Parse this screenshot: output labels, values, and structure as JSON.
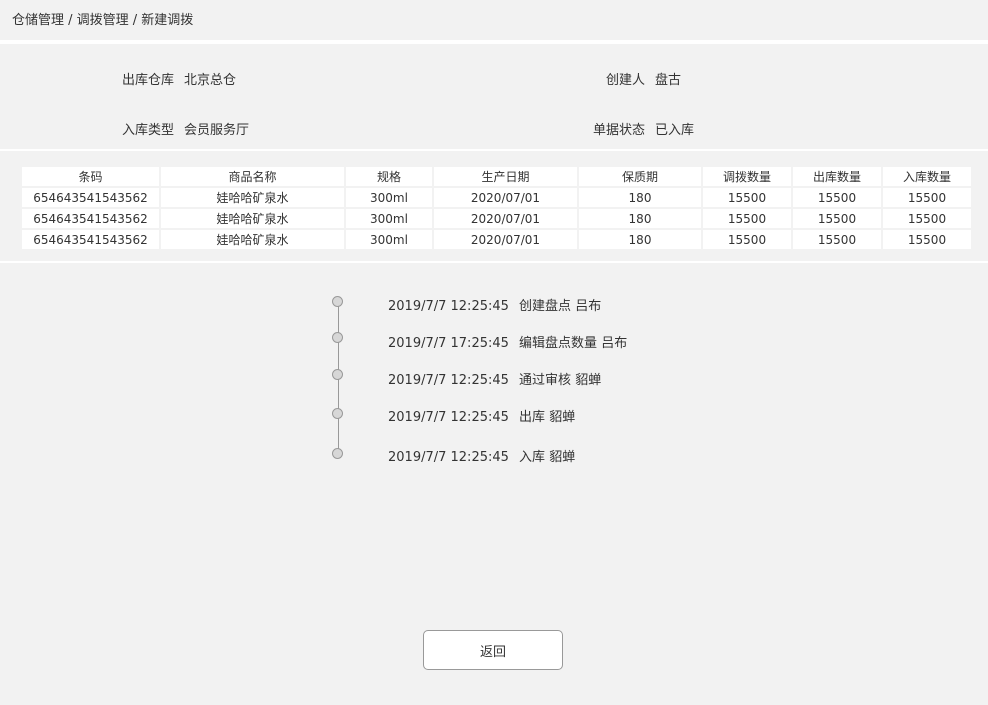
{
  "breadcrumb": "仓储管理 / 调拨管理 / 新建调拨",
  "info": {
    "out_warehouse": {
      "label": "出库仓库",
      "value": "北京总仓"
    },
    "creator": {
      "label": "创建人",
      "value": "盘古"
    },
    "in_type": {
      "label": "入库类型",
      "value": "会员服务厅"
    },
    "status": {
      "label": "单据状态",
      "value": "已入库"
    }
  },
  "table": {
    "headers": [
      "条码",
      "商品名称",
      "规格",
      "生产日期",
      "保质期",
      "调拨数量",
      "出库数量",
      "入库数量"
    ],
    "rows": [
      [
        "654643541543562",
        "娃哈哈矿泉水",
        "300ml",
        "2020/07/01",
        "180",
        "15500",
        "15500",
        "15500"
      ],
      [
        "654643541543562",
        "娃哈哈矿泉水",
        "300ml",
        "2020/07/01",
        "180",
        "15500",
        "15500",
        "15500"
      ],
      [
        "654643541543562",
        "娃哈哈矿泉水",
        "300ml",
        "2020/07/01",
        "180",
        "15500",
        "15500",
        "15500"
      ]
    ]
  },
  "timeline": [
    {
      "time": "2019/7/7 12:25:45",
      "action": "创建盘点",
      "user": "吕布"
    },
    {
      "time": "2019/7/7 17:25:45",
      "action": "编辑盘点数量",
      "user": "吕布"
    },
    {
      "time": "2019/7/7 12:25:45",
      "action": "通过审核",
      "user": "貂蝉"
    },
    {
      "time": "2019/7/7 12:25:45",
      "action": "出库",
      "user": "貂蝉"
    },
    {
      "time": "2019/7/7 12:25:45",
      "action": "入库",
      "user": "貂蝉"
    }
  ],
  "back_label": "返回"
}
